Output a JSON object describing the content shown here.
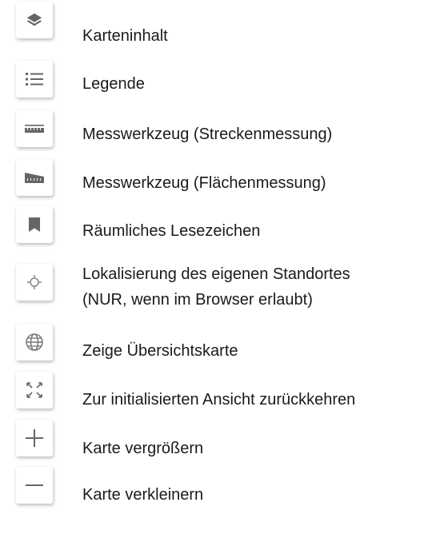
{
  "items": [
    {
      "label": "Karteninhalt",
      "icon": "layers-icon"
    },
    {
      "label": "Legende",
      "icon": "list-icon"
    },
    {
      "label": "Messwerkzeug (Streckenmessung)",
      "icon": "ruler-line-icon"
    },
    {
      "label": "Messwerkzeug (Flächenmessung)",
      "icon": "ruler-area-icon"
    },
    {
      "label": "Räumliches Lesezeichen",
      "icon": "bookmark-icon"
    },
    {
      "label": "Lokalisierung des eigenen Standortes",
      "label_line2": "(NUR, wenn im Browser erlaubt)",
      "icon": "crosshair-icon"
    },
    {
      "label": "Zeige Übersichtskarte",
      "icon": "globe-icon"
    },
    {
      "label": "Zur initialisierten Ansicht zurückkehren",
      "icon": "reset-view-icon"
    },
    {
      "label": "Karte vergrößern",
      "icon": "zoom-in-icon"
    },
    {
      "label": "Karte verkleinern",
      "icon": "zoom-out-icon"
    }
  ],
  "colors": {
    "icon": "#666666",
    "text": "#1a1a1a",
    "button_bg": "#ffffff"
  }
}
